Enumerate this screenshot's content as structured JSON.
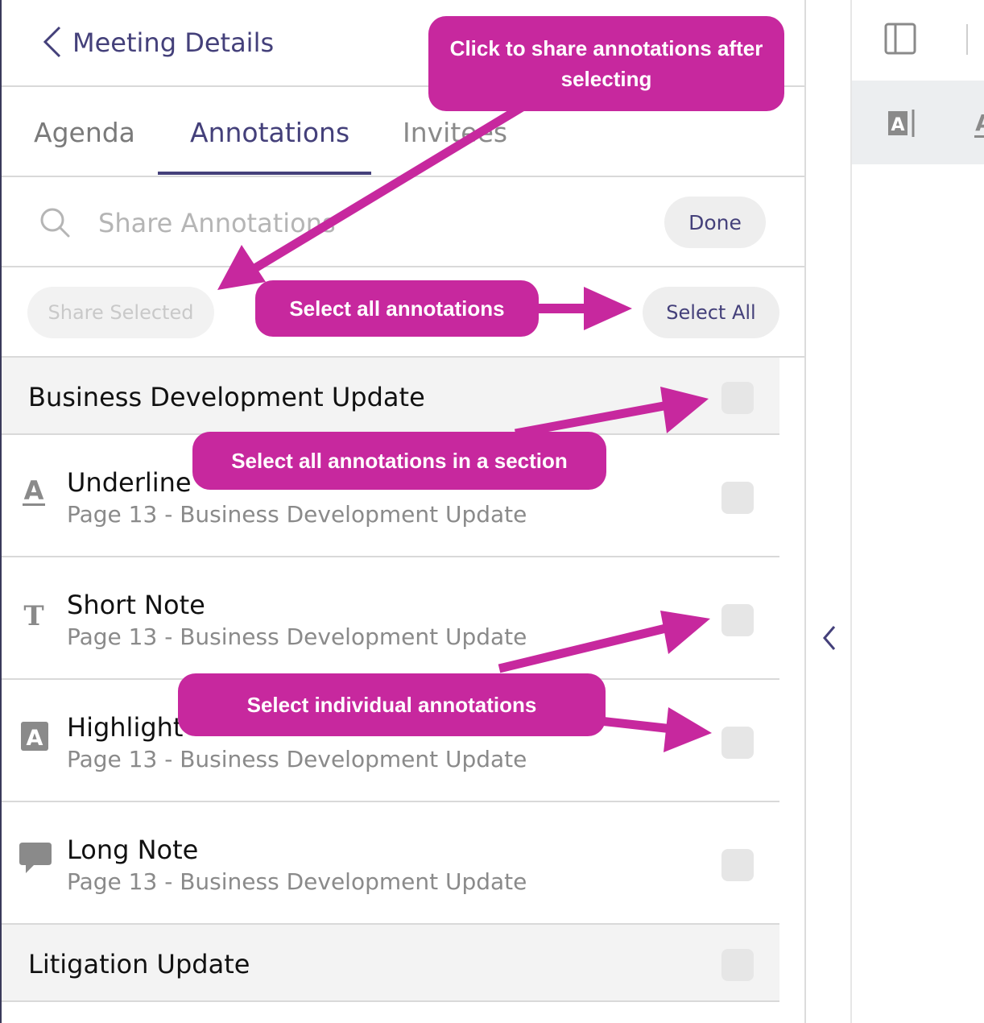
{
  "header": {
    "back_label": "Meeting Details"
  },
  "tabs": [
    {
      "label": "Agenda",
      "active": false
    },
    {
      "label": "Annotations",
      "active": true
    },
    {
      "label": "Invitees",
      "active": false
    }
  ],
  "search": {
    "placeholder": "Share Annotations",
    "done_label": "Done"
  },
  "actions": {
    "share_selected_label": "Share Selected",
    "select_all_label": "Select All"
  },
  "sections": [
    {
      "title": "Business Development Update",
      "checked": false,
      "items": [
        {
          "icon": "underline-icon",
          "title": "Underline",
          "subtitle": "Page 13 - Business Development Update",
          "checked": false
        },
        {
          "icon": "text-note-icon",
          "title": "Short Note",
          "subtitle": "Page 13 - Business Development Update",
          "checked": false
        },
        {
          "icon": "highlight-icon",
          "title": "Highlight",
          "subtitle": "Page 13 - Business Development Update",
          "checked": false
        },
        {
          "icon": "comment-icon",
          "title": "Long Note",
          "subtitle": "Page 13 - Business Development Update",
          "checked": false
        }
      ]
    },
    {
      "title": "Litigation Update",
      "checked": false,
      "items": []
    }
  ],
  "callouts": {
    "share": "Click to share annotations after selecting",
    "select_all": "Select all annotations",
    "section": "Select all annotations in a section",
    "individual": "Select individual annotations"
  },
  "colors": {
    "accent": "#44407a",
    "callout": "#c7289e",
    "section_bg": "#f3f3f3",
    "checkbox": "#e6e6e6"
  }
}
